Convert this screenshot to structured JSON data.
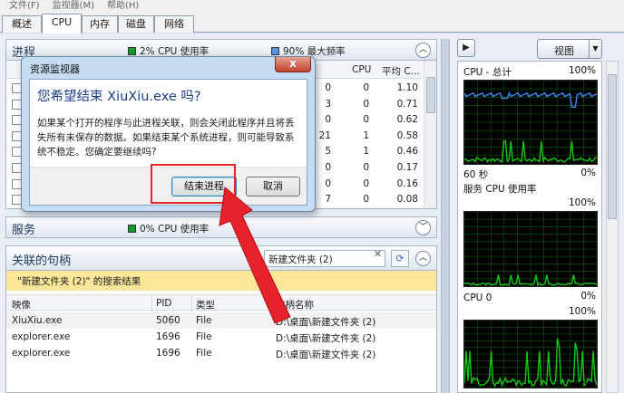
{
  "menu": [
    "文件(F)",
    "监视器(M)",
    "帮助(H)"
  ],
  "tabs": [
    "概述",
    "CPU",
    "内存",
    "磁盘",
    "网络"
  ],
  "active_tab": 1,
  "processes": {
    "title": "进程",
    "cpu_usage_label": "2% CPU 使用率",
    "max_freq_label": "90% 最大频率",
    "col_cpu": "CPU",
    "col_avg": "平均 C...",
    "rows": [
      {
        "cpu": "0",
        "avg": "1.10",
        "prefix": "0"
      },
      {
        "cpu": "0",
        "avg": "0.71",
        "prefix": "3"
      },
      {
        "cpu": "0",
        "avg": "0.62",
        "prefix": "0"
      },
      {
        "cpu": "1",
        "avg": "0.58",
        "prefix": "21"
      },
      {
        "cpu": "1",
        "avg": "0.46",
        "prefix": "5"
      },
      {
        "cpu": "0",
        "avg": "0.17",
        "prefix": "0"
      },
      {
        "cpu": "0",
        "avg": "0.16",
        "prefix": "0"
      },
      {
        "cpu": "0",
        "avg": "0.08",
        "prefix": "7"
      }
    ]
  },
  "services": {
    "title": "服务",
    "cpu_usage_label": "0% CPU 使用率"
  },
  "handles": {
    "title": "关联的句柄",
    "search_value": "新建文件夹 (2)",
    "banner": "\"新建文件夹 (2)\" 的搜索结果",
    "columns": [
      "映像",
      "PID",
      "类型",
      "句柄名称"
    ],
    "rows": [
      {
        "image": "XiuXiu.exe",
        "pid": "5060",
        "type": "File",
        "name": "D:\\桌面\\新建文件夹 (2)"
      },
      {
        "image": "explorer.exe",
        "pid": "1696",
        "type": "File",
        "name": "D:\\桌面\\新建文件夹 (2)"
      },
      {
        "image": "explorer.exe",
        "pid": "1696",
        "type": "File",
        "name": "D:\\桌面\\新建文件夹 (2)"
      }
    ]
  },
  "right": {
    "view_label": "视图",
    "graphs": [
      {
        "title": "CPU - 总计",
        "top_value": "100%",
        "bottom_left": "60 秒",
        "bottom_right": "0%"
      },
      {
        "title": "服务 CPU 使用率",
        "top_value": "100%",
        "bottom_left": "",
        "bottom_right": "0%"
      },
      {
        "title": "CPU 0",
        "top_value": "100%",
        "bottom_left": "",
        "bottom_right": "0%"
      }
    ]
  },
  "dialog": {
    "title": "资源监视器",
    "question": "您希望结束 XiuXiu.exe 吗?",
    "message": "如果某个打开的程序与此进程关联，则会关闭此程序并且将丢失所有未保存的数据。如果结束某个系统进程，则可能导致系统不稳定。您确定要继续吗?",
    "ok_label": "结束进程",
    "cancel_label": "取消",
    "close_label": "x"
  },
  "colors": {
    "highlight_box": "#e6232b",
    "arrow": "#e6232b",
    "graph_line_green": "#14c814",
    "graph_line_blue": "#3b8fff",
    "banner": "#fbe69a"
  }
}
